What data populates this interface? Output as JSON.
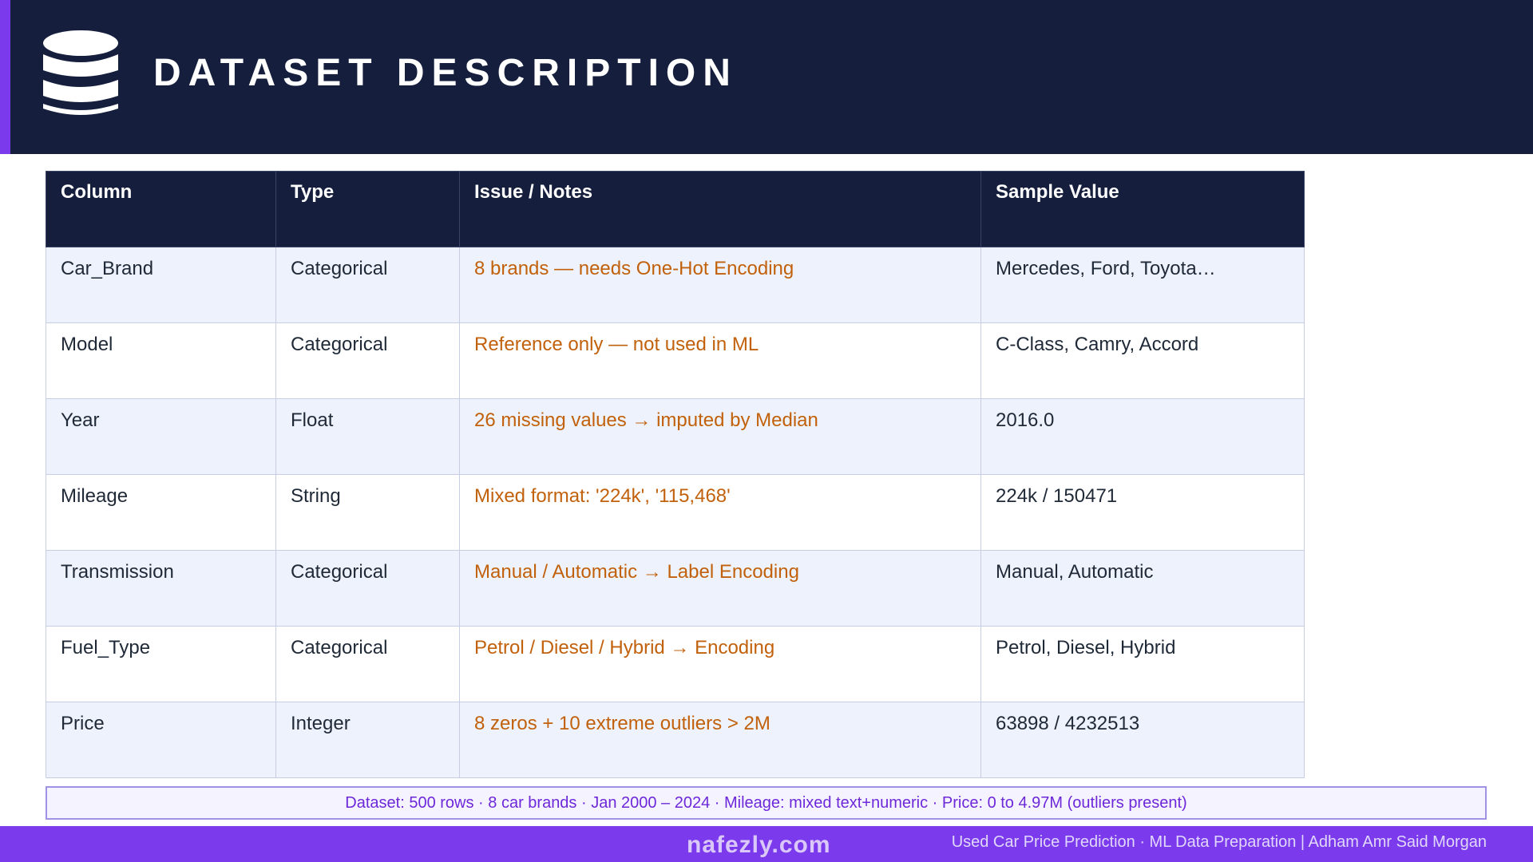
{
  "header": {
    "title": "DATASET DESCRIPTION",
    "icon": "database-icon",
    "background": "#151f3d",
    "accent": "#7c3aed"
  },
  "table": {
    "columns": [
      "Column",
      "Type",
      "Issue / Notes",
      "Sample Value"
    ],
    "rows": [
      {
        "column": "Car_Brand",
        "type": "Categorical",
        "note": "8 brands — needs One-Hot Encoding",
        "sample": "Mercedes, Ford, Toyota…"
      },
      {
        "column": "Model",
        "type": "Categorical",
        "note": "Reference only — not used in ML",
        "sample": "C-Class, Camry, Accord"
      },
      {
        "column": "Year",
        "type": "Float",
        "note": "26 missing values → imputed by Median",
        "sample": "2016.0"
      },
      {
        "column": "Mileage",
        "type": "String",
        "note": "Mixed format: '224k', '115,468'",
        "sample": "224k / 150471"
      },
      {
        "column": "Transmission",
        "type": "Categorical",
        "note": "Manual / Automatic → Label Encoding",
        "sample": "Manual, Automatic"
      },
      {
        "column": "Fuel_Type",
        "type": "Categorical",
        "note": "Petrol / Diesel / Hybrid → Encoding",
        "sample": "Petrol, Diesel, Hybrid"
      },
      {
        "column": "Price",
        "type": "Integer",
        "note": "8 zeros + 10 extreme outliers > 2M",
        "sample": "63898 / 4232513"
      }
    ],
    "note_color": "#c2610c"
  },
  "summary": {
    "text": "Dataset: 500 rows · 8 car brands · Jan 2000 – 2024 · Mileage: mixed text+numeric · Price: 0 to 4.97M (outliers present)"
  },
  "footer": {
    "credit": "Used Car Price Prediction · ML Data Preparation  |  Adham Amr Said Morgan",
    "watermark": "nafezly.com"
  }
}
